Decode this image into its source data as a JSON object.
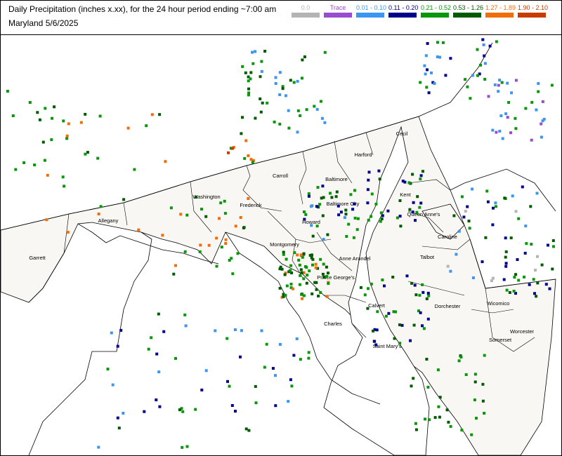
{
  "title": {
    "line1": "Daily Precipitation (inches  x.xx),  for the 24 hour period ending ~7:00 am",
    "line2": "Maryland 5/6/2025"
  },
  "legend": [
    {
      "label": "0.0",
      "color": "#b4b4b4"
    },
    {
      "label": "Trace",
      "color": "#9a4cd0"
    },
    {
      "label": "0.01 - 0.10",
      "color": "#3a96f0"
    },
    {
      "label": "0.11 - 0.20",
      "color": "#00008c"
    },
    {
      "label": "0.21 - 0.52",
      "color": "#0a960a"
    },
    {
      "label": "0.53 - 1.26",
      "color": "#005a00"
    },
    {
      "label": "1.27 - 1.89",
      "color": "#f06e0a"
    },
    {
      "label": "1.90 - 2.10",
      "color": "#c83c00"
    }
  ],
  "counties": [
    "Garrett",
    "Allegany",
    "Washington",
    "Frederick",
    "Carroll",
    "Baltimore",
    "Harford",
    "Cecil",
    "Baltimore City",
    "Howard",
    "Montgomery",
    "Prince George's",
    "Anne Arundel",
    "Kent",
    "Queen Anne's",
    "Caroline",
    "Talbot",
    "Dorchester",
    "Wicomico",
    "Worcester",
    "Somerset",
    "Calvert",
    "Charles",
    "Saint Mary's"
  ],
  "colors": {
    "state_fill": "#f8f7f3",
    "border": "#000000",
    "water": "#ffffff"
  }
}
